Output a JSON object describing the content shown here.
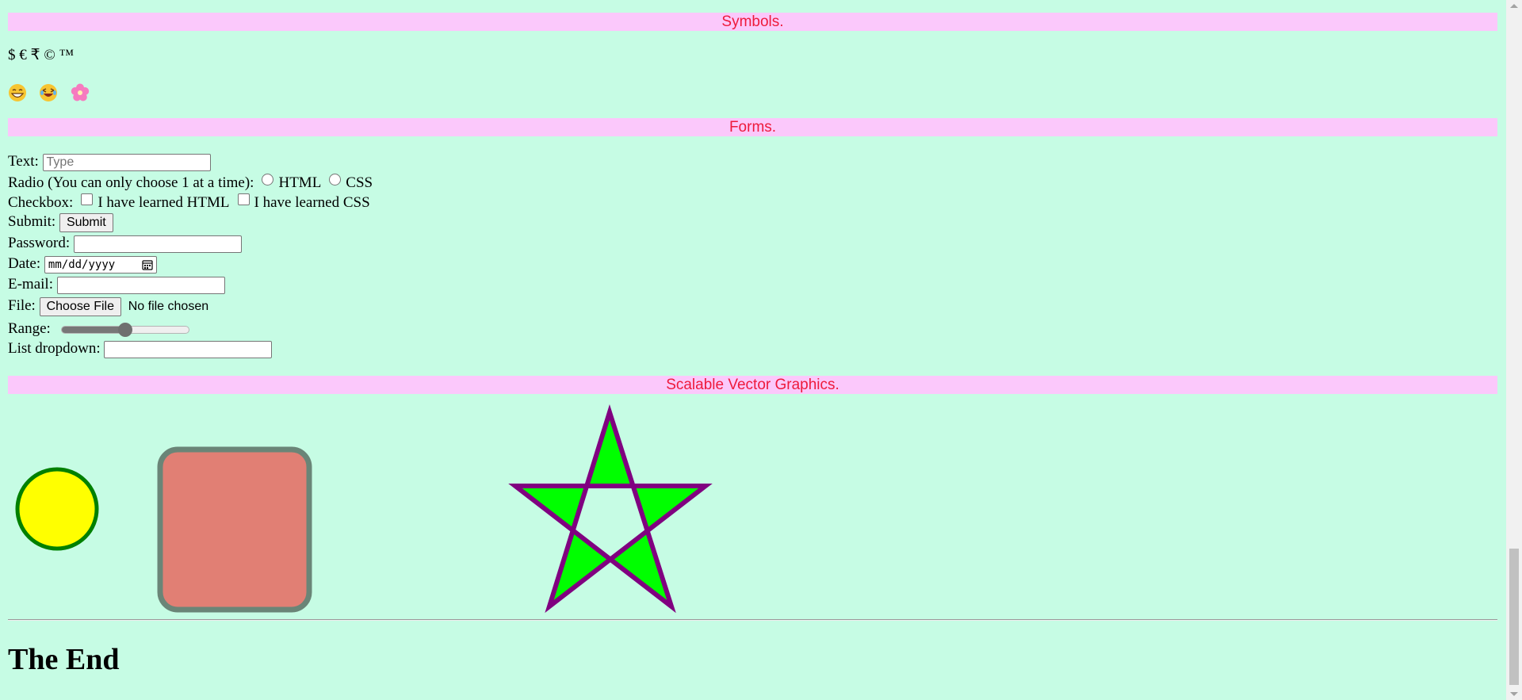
{
  "sections": {
    "symbols": "Symbols.",
    "forms": "Forms.",
    "svg": "Scalable Vector Graphics."
  },
  "symbols": {
    "text": "$ € ₹ © ™"
  },
  "emojis": [
    "grinning-face-icon",
    "laughing-face-icon",
    "pink-flower-icon"
  ],
  "forms": {
    "text_label": "Text:",
    "text_placeholder": "Type",
    "radio_label": "Radio (You can only choose 1 at a time):",
    "radio_options": [
      "HTML",
      "CSS"
    ],
    "checkbox_label": "Checkbox:",
    "checkbox_options": [
      "I have learned HTML",
      "I have learned CSS"
    ],
    "submit_label": "Submit:",
    "submit_button": "Submit",
    "password_label": "Password:",
    "date_label": "Date:",
    "date_placeholder": "mm/dd/yyyy",
    "email_label": "E-mail:",
    "file_label": "File:",
    "file_button": "Choose File",
    "file_status": "No file chosen",
    "range_label": "Range:",
    "range_value": 0.5,
    "list_label": "List dropdown:"
  },
  "svg_colors": {
    "circle_fill": "#ffff00",
    "circle_stroke": "#008000",
    "rect_fill": "#e17f74",
    "rect_stroke": "#6a8577",
    "star_fill": "#00ff00",
    "star_stroke": "#800080"
  },
  "footer": {
    "title": "The End"
  }
}
